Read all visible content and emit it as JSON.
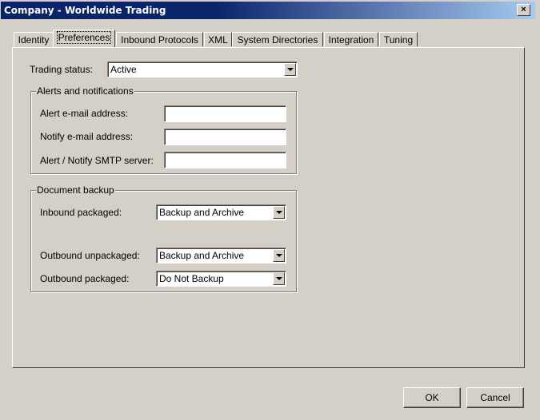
{
  "window": {
    "title": "Company - Worldwide Trading",
    "close_glyph": "×"
  },
  "tabs": [
    {
      "label": "Identity"
    },
    {
      "label": "Preferences",
      "active": true
    },
    {
      "label": "Inbound Protocols"
    },
    {
      "label": "XML"
    },
    {
      "label": "System Directories"
    },
    {
      "label": "Integration"
    },
    {
      "label": "Tuning"
    }
  ],
  "preferences": {
    "trading_status": {
      "label": "Trading status:",
      "value": "Active"
    },
    "alerts": {
      "title": "Alerts and notifications",
      "alert_email": {
        "label": "Alert e-mail address:",
        "value": ""
      },
      "notify_email": {
        "label": "Notify e-mail address:",
        "value": ""
      },
      "smtp_server": {
        "label": "Alert / Notify SMTP server:",
        "value": ""
      }
    },
    "backup": {
      "title": "Document backup",
      "inbound_packaged": {
        "label": "Inbound packaged:",
        "value": "Backup and Archive"
      },
      "outbound_unpackaged": {
        "label": "Outbound unpackaged:",
        "value": "Backup and Archive"
      },
      "outbound_packaged": {
        "label": "Outbound packaged:",
        "value": "Do Not Backup"
      }
    }
  },
  "buttons": {
    "ok": "OK",
    "cancel": "Cancel"
  }
}
